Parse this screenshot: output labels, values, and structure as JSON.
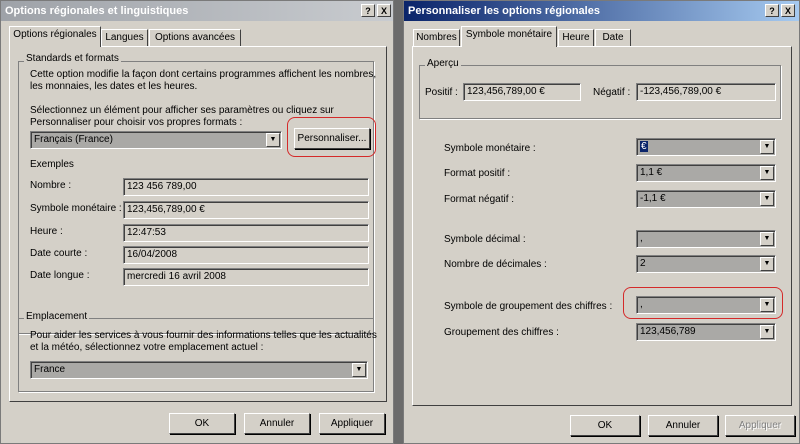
{
  "left_window": {
    "title": "Options régionales et linguistiques",
    "title_buttons": [
      "?",
      "X"
    ],
    "tabs": [
      "Options régionales",
      "Langues",
      "Options avancées"
    ],
    "standards_group": {
      "label": "Standards et formats",
      "description": "Cette option modifie la façon dont certains programmes affichent les nombres,\nles monnaies, les dates et les heures.",
      "instruction": "Sélectionnez un élément pour afficher ses paramètres ou cliquez sur\nPersonnaliser pour choisir vos propres formats :",
      "locale_value": "Français (France)",
      "customize_button": "Personnaliser...",
      "examples_label": "Exemples",
      "examples": [
        {
          "label": "Nombre :",
          "value": "123 456 789,00"
        },
        {
          "label": "Symbole monétaire :",
          "value": "123,456,789,00 €"
        },
        {
          "label": "Heure :",
          "value": "12:47:53"
        },
        {
          "label": "Date courte :",
          "value": "16/04/2008"
        },
        {
          "label": "Date longue :",
          "value": "mercredi 16 avril 2008"
        }
      ]
    },
    "location_group": {
      "label": "Emplacement",
      "description": "Pour aider les services à vous fournir des informations telles que les actualités\net la météo, sélectionnez votre emplacement actuel :",
      "value": "France"
    },
    "buttons": {
      "ok": "OK",
      "cancel": "Annuler",
      "apply": "Appliquer"
    }
  },
  "right_window": {
    "title": "Personnaliser les options régionales",
    "title_buttons": [
      "?",
      "X"
    ],
    "tabs": [
      "Nombres",
      "Symbole monétaire",
      "Heure",
      "Date"
    ],
    "preview": {
      "label": "Aperçu",
      "positive_label": "Positif :",
      "positive_value": "123,456,789,00 €",
      "negative_label": "Négatif :",
      "negative_value": "-123,456,789,00 €"
    },
    "fields": [
      {
        "label": "Symbole monétaire :",
        "value": "€"
      },
      {
        "label": "Format positif :",
        "value": "1,1 €"
      },
      {
        "label": "Format négatif :",
        "value": "-1,1 €"
      },
      {
        "label": "Symbole décimal :",
        "value": ","
      },
      {
        "label": "Nombre de décimales :",
        "value": "2"
      },
      {
        "label": "Symbole de groupement des chiffres :",
        "value": ","
      },
      {
        "label": "Groupement des chiffres :",
        "value": "123,456,789"
      }
    ],
    "buttons": {
      "ok": "OK",
      "cancel": "Annuler",
      "apply": "Appliquer"
    }
  },
  "colors": {
    "highlight_circle": "#d42a2a",
    "titlebar_active": "#0a246a",
    "dialog": "#d4d0c8"
  },
  "icons": {
    "dropdown": "chevron-down-icon",
    "help": "help-icon",
    "close": "close-icon"
  }
}
